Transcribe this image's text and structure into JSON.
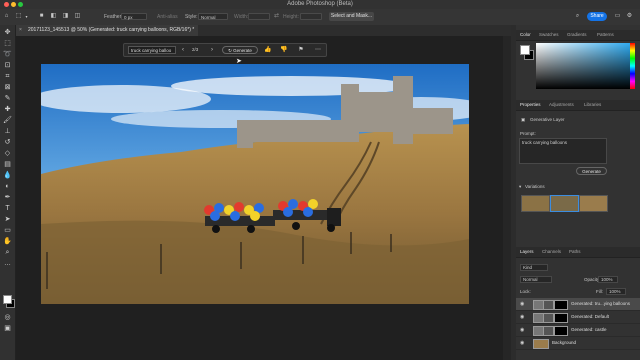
{
  "window": {
    "title": "Adobe Photoshop (Beta)"
  },
  "options_bar": {
    "feather_label": "Feather:",
    "feather_value": "0 px",
    "anti_alias_label": "Anti-alias",
    "style_label": "Style:",
    "style_value": "Normal",
    "width_label": "Width:",
    "height_label": "Height:",
    "select_mask_label": "Select and Mask...",
    "share_label": "Share"
  },
  "document_tab": {
    "title": "20171123_145513 @ 50% (Generated: truck carrying balloons, RGB/16*) *"
  },
  "contextual_taskbar": {
    "prompt": "truck carrying balloo",
    "counter": "2/3",
    "generate_label": "Generate"
  },
  "color_panel": {
    "tabs": [
      "Color",
      "Swatches",
      "Gradients",
      "Patterns"
    ],
    "foreground": "#ffffff",
    "background": "#000000",
    "hue_color": "#27a7ef"
  },
  "properties_panel": {
    "tabs": [
      "Properties",
      "Adjustments",
      "Libraries"
    ],
    "layer_type": "Generative Layer",
    "prompt_label": "Prompt:",
    "prompt_value": "truck carrying balloons",
    "generate_label": "Generate",
    "variations_label": "Variations"
  },
  "layers_panel": {
    "tabs": [
      "Layers",
      "Channels",
      "Paths"
    ],
    "kind_label": "Kind",
    "blend_mode": "Normal",
    "opacity_label": "Opacity:",
    "opacity_value": "100%",
    "lock_label": "Lock:",
    "fill_label": "Fill:",
    "fill_value": "100%",
    "layers": [
      {
        "name": "Generated: tru...ying balloons",
        "selected": true
      },
      {
        "name": "Generated: Default",
        "selected": false
      },
      {
        "name": "Generated: castle",
        "selected": false
      },
      {
        "name": "Background",
        "selected": false
      }
    ]
  }
}
